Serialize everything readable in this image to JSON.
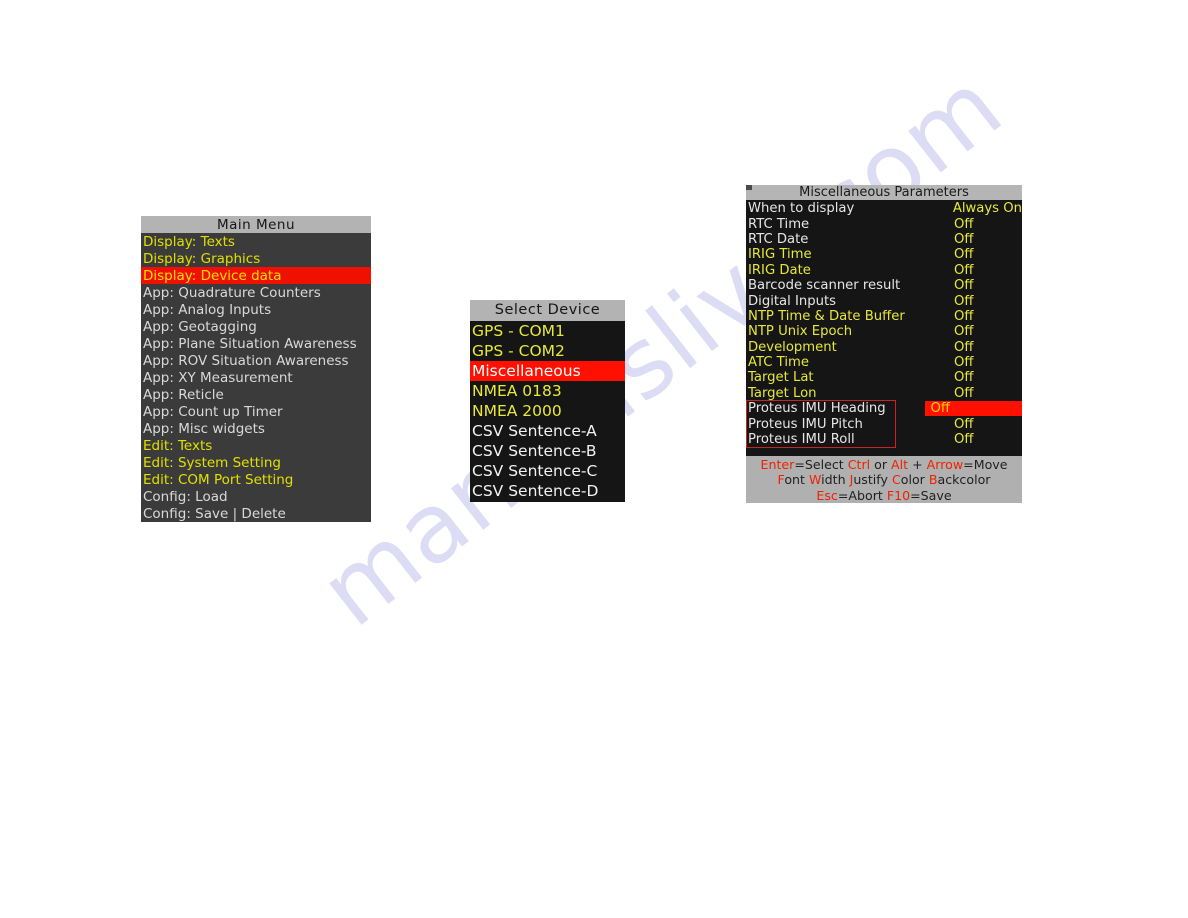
{
  "watermark": {
    "text": "manualslive.com"
  },
  "colors": {
    "panel_bg": "#151515",
    "menu_bg": "#3b3b3b",
    "title_bg": "#b3b3b3",
    "selection_red": "#ff1000",
    "accent_yellow": "#e8e83a",
    "text_white": "#f2f2f2",
    "help_red": "#ee2200"
  },
  "main_menu": {
    "title": "Main Menu",
    "items": [
      {
        "label": "Display: Texts",
        "style": "yellow"
      },
      {
        "label": "Display: Graphics",
        "style": "yellow"
      },
      {
        "label": "Display: Device data",
        "style": "selected"
      },
      {
        "label": "App: Quadrature Counters",
        "style": "white"
      },
      {
        "label": "App: Analog Inputs",
        "style": "white"
      },
      {
        "label": "App: Geotagging",
        "style": "white"
      },
      {
        "label": "App: Plane Situation Awareness",
        "style": "white"
      },
      {
        "label": "App: ROV Situation Awareness",
        "style": "white"
      },
      {
        "label": "App: XY Measurement",
        "style": "white"
      },
      {
        "label": "App: Reticle",
        "style": "white"
      },
      {
        "label": "App: Count up Timer",
        "style": "white"
      },
      {
        "label": "App: Misc widgets",
        "style": "white"
      },
      {
        "label": "Edit: Texts",
        "style": "yellow"
      },
      {
        "label": "Edit: System Setting",
        "style": "yellow"
      },
      {
        "label": "Edit: COM Port Setting",
        "style": "yellow"
      },
      {
        "label": "Config: Load",
        "style": "white"
      },
      {
        "label": "Config: Save | Delete",
        "style": "white"
      }
    ]
  },
  "select_device": {
    "title": "Select Device",
    "items": [
      {
        "label": "GPS - COM1",
        "style": "yellow"
      },
      {
        "label": "GPS - COM2",
        "style": "yellow"
      },
      {
        "label": "Miscellaneous",
        "style": "selected"
      },
      {
        "label": "NMEA 0183",
        "style": "yellow"
      },
      {
        "label": "NMEA 2000",
        "style": "yellow"
      },
      {
        "label": "CSV Sentence-A",
        "style": "white"
      },
      {
        "label": "CSV Sentence-B",
        "style": "white"
      },
      {
        "label": "CSV Sentence-C",
        "style": "white"
      },
      {
        "label": "CSV Sentence-D",
        "style": "white"
      }
    ]
  },
  "misc_params": {
    "title": "Miscellaneous Parameters",
    "rows": [
      {
        "key": "When to display",
        "value": "Always On",
        "key_style": "white",
        "value_selected": false
      },
      {
        "key": "RTC Time",
        "value": "Off",
        "key_style": "white",
        "value_selected": false
      },
      {
        "key": "RTC Date",
        "value": "Off",
        "key_style": "white",
        "value_selected": false
      },
      {
        "key": "IRIG Time",
        "value": "Off",
        "key_style": "yellow",
        "value_selected": false
      },
      {
        "key": "IRIG Date",
        "value": "Off",
        "key_style": "yellow",
        "value_selected": false
      },
      {
        "key": "Barcode scanner result",
        "value": "Off",
        "key_style": "white",
        "value_selected": false
      },
      {
        "key": "Digital Inputs",
        "value": "Off",
        "key_style": "white",
        "value_selected": false
      },
      {
        "key": "NTP Time & Date Buffer",
        "value": "Off",
        "key_style": "yellow",
        "value_selected": false
      },
      {
        "key": "NTP Unix Epoch",
        "value": "Off",
        "key_style": "yellow",
        "value_selected": false
      },
      {
        "key": "Development",
        "value": "Off",
        "key_style": "yellow",
        "value_selected": false
      },
      {
        "key": "ATC Time",
        "value": "Off",
        "key_style": "yellow",
        "value_selected": false
      },
      {
        "key": "Target Lat",
        "value": "Off",
        "key_style": "yellow",
        "value_selected": false
      },
      {
        "key": "Target Lon",
        "value": "Off",
        "key_style": "yellow",
        "value_selected": false
      },
      {
        "key": "Proteus IMU Heading",
        "value": "Off",
        "key_style": "white",
        "value_selected": true
      },
      {
        "key": "Proteus IMU Pitch",
        "value": "Off",
        "key_style": "white",
        "value_selected": false
      },
      {
        "key": "Proteus IMU Roll",
        "value": "Off",
        "key_style": "white",
        "value_selected": false
      }
    ],
    "help": {
      "line1": [
        {
          "t": "Enter",
          "c": "red"
        },
        {
          "t": "=Select ",
          "c": "dark"
        },
        {
          "t": "Ctrl",
          "c": "red"
        },
        {
          "t": " or ",
          "c": "dark"
        },
        {
          "t": "Alt",
          "c": "red"
        },
        {
          "t": " + ",
          "c": "dark"
        },
        {
          "t": "Arrow",
          "c": "red"
        },
        {
          "t": "=Move",
          "c": "dark"
        }
      ],
      "line2": [
        {
          "t": "F",
          "c": "red"
        },
        {
          "t": "ont ",
          "c": "dark"
        },
        {
          "t": "W",
          "c": "red"
        },
        {
          "t": "idth ",
          "c": "dark"
        },
        {
          "t": "J",
          "c": "red"
        },
        {
          "t": "ustify ",
          "c": "dark"
        },
        {
          "t": "C",
          "c": "red"
        },
        {
          "t": "olor ",
          "c": "dark"
        },
        {
          "t": "B",
          "c": "red"
        },
        {
          "t": "ackcolor",
          "c": "dark"
        }
      ],
      "line3": [
        {
          "t": "Esc",
          "c": "red"
        },
        {
          "t": "=Abort ",
          "c": "dark"
        },
        {
          "t": "F10",
          "c": "red"
        },
        {
          "t": "=Save",
          "c": "dark"
        }
      ]
    }
  }
}
